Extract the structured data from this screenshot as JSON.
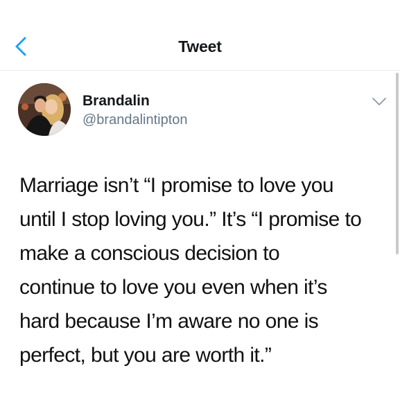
{
  "header": {
    "title": "Tweet",
    "back_icon": "chevron-left-icon",
    "accent_color": "#1da1f2"
  },
  "tweet": {
    "author_name": "Brandalin",
    "author_handle": "@brandalintipton",
    "menu_icon": "chevron-down-icon",
    "text": "Marriage isn’t “I promise to love you\nuntil I stop loving you.” It’s “I promise to\nmake a conscious decision to\ncontinue to love you even when it’s\nhard because I’m aware no one is\nperfect, but you are worth it.”"
  }
}
